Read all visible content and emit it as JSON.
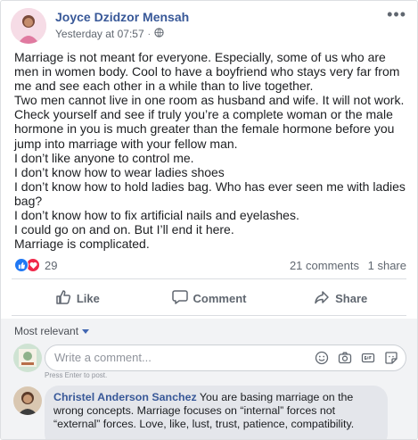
{
  "post": {
    "author": "Joyce Dzidzor Mensah",
    "timestamp": "Yesterday at 07:57",
    "more_label": "•••",
    "paragraphs": [
      "Marriage is not meant for everyone. Especially, some of us who are men in women body. Cool to have a boyfriend who stays very far from me and see each other in a while than to live together.",
      "Two men cannot live in one room as husband and wife. It will not work.",
      "Check yourself and see if truly you’re a complete woman or the male hormone in you is much greater than the female hormone before you jump into marriage with your fellow man.",
      "I don’t like anyone to control me.",
      "I don’t know how to wear ladies shoes",
      "I don’t know how to hold ladies bag. Who has ever seen me with ladies bag?",
      "I don’t know how to fix artificial nails and eyelashes.",
      "I could go on and on. But I’ll end it here.",
      "Marriage is complicated."
    ]
  },
  "stats": {
    "reaction_count": "29",
    "comments": "21 comments",
    "shares": "1 share"
  },
  "actions": {
    "like": "Like",
    "comment": "Comment",
    "share": "Share"
  },
  "comments_section": {
    "sort_label": "Most relevant",
    "composer_placeholder": "Write a comment...",
    "hint": "Press Enter to post.",
    "first_comment": {
      "author": "Christel Anderson Sanchez",
      "text": " You are basing marriage on the wrong concepts. Marriage focuses on “internal” forces not “external” forces. Love, like, lust, trust, patience, compatibility."
    }
  },
  "colors": {
    "link_blue": "#385898",
    "like_blue": "#2078f4",
    "love_red": "#f0284a",
    "muted": "#606770"
  }
}
